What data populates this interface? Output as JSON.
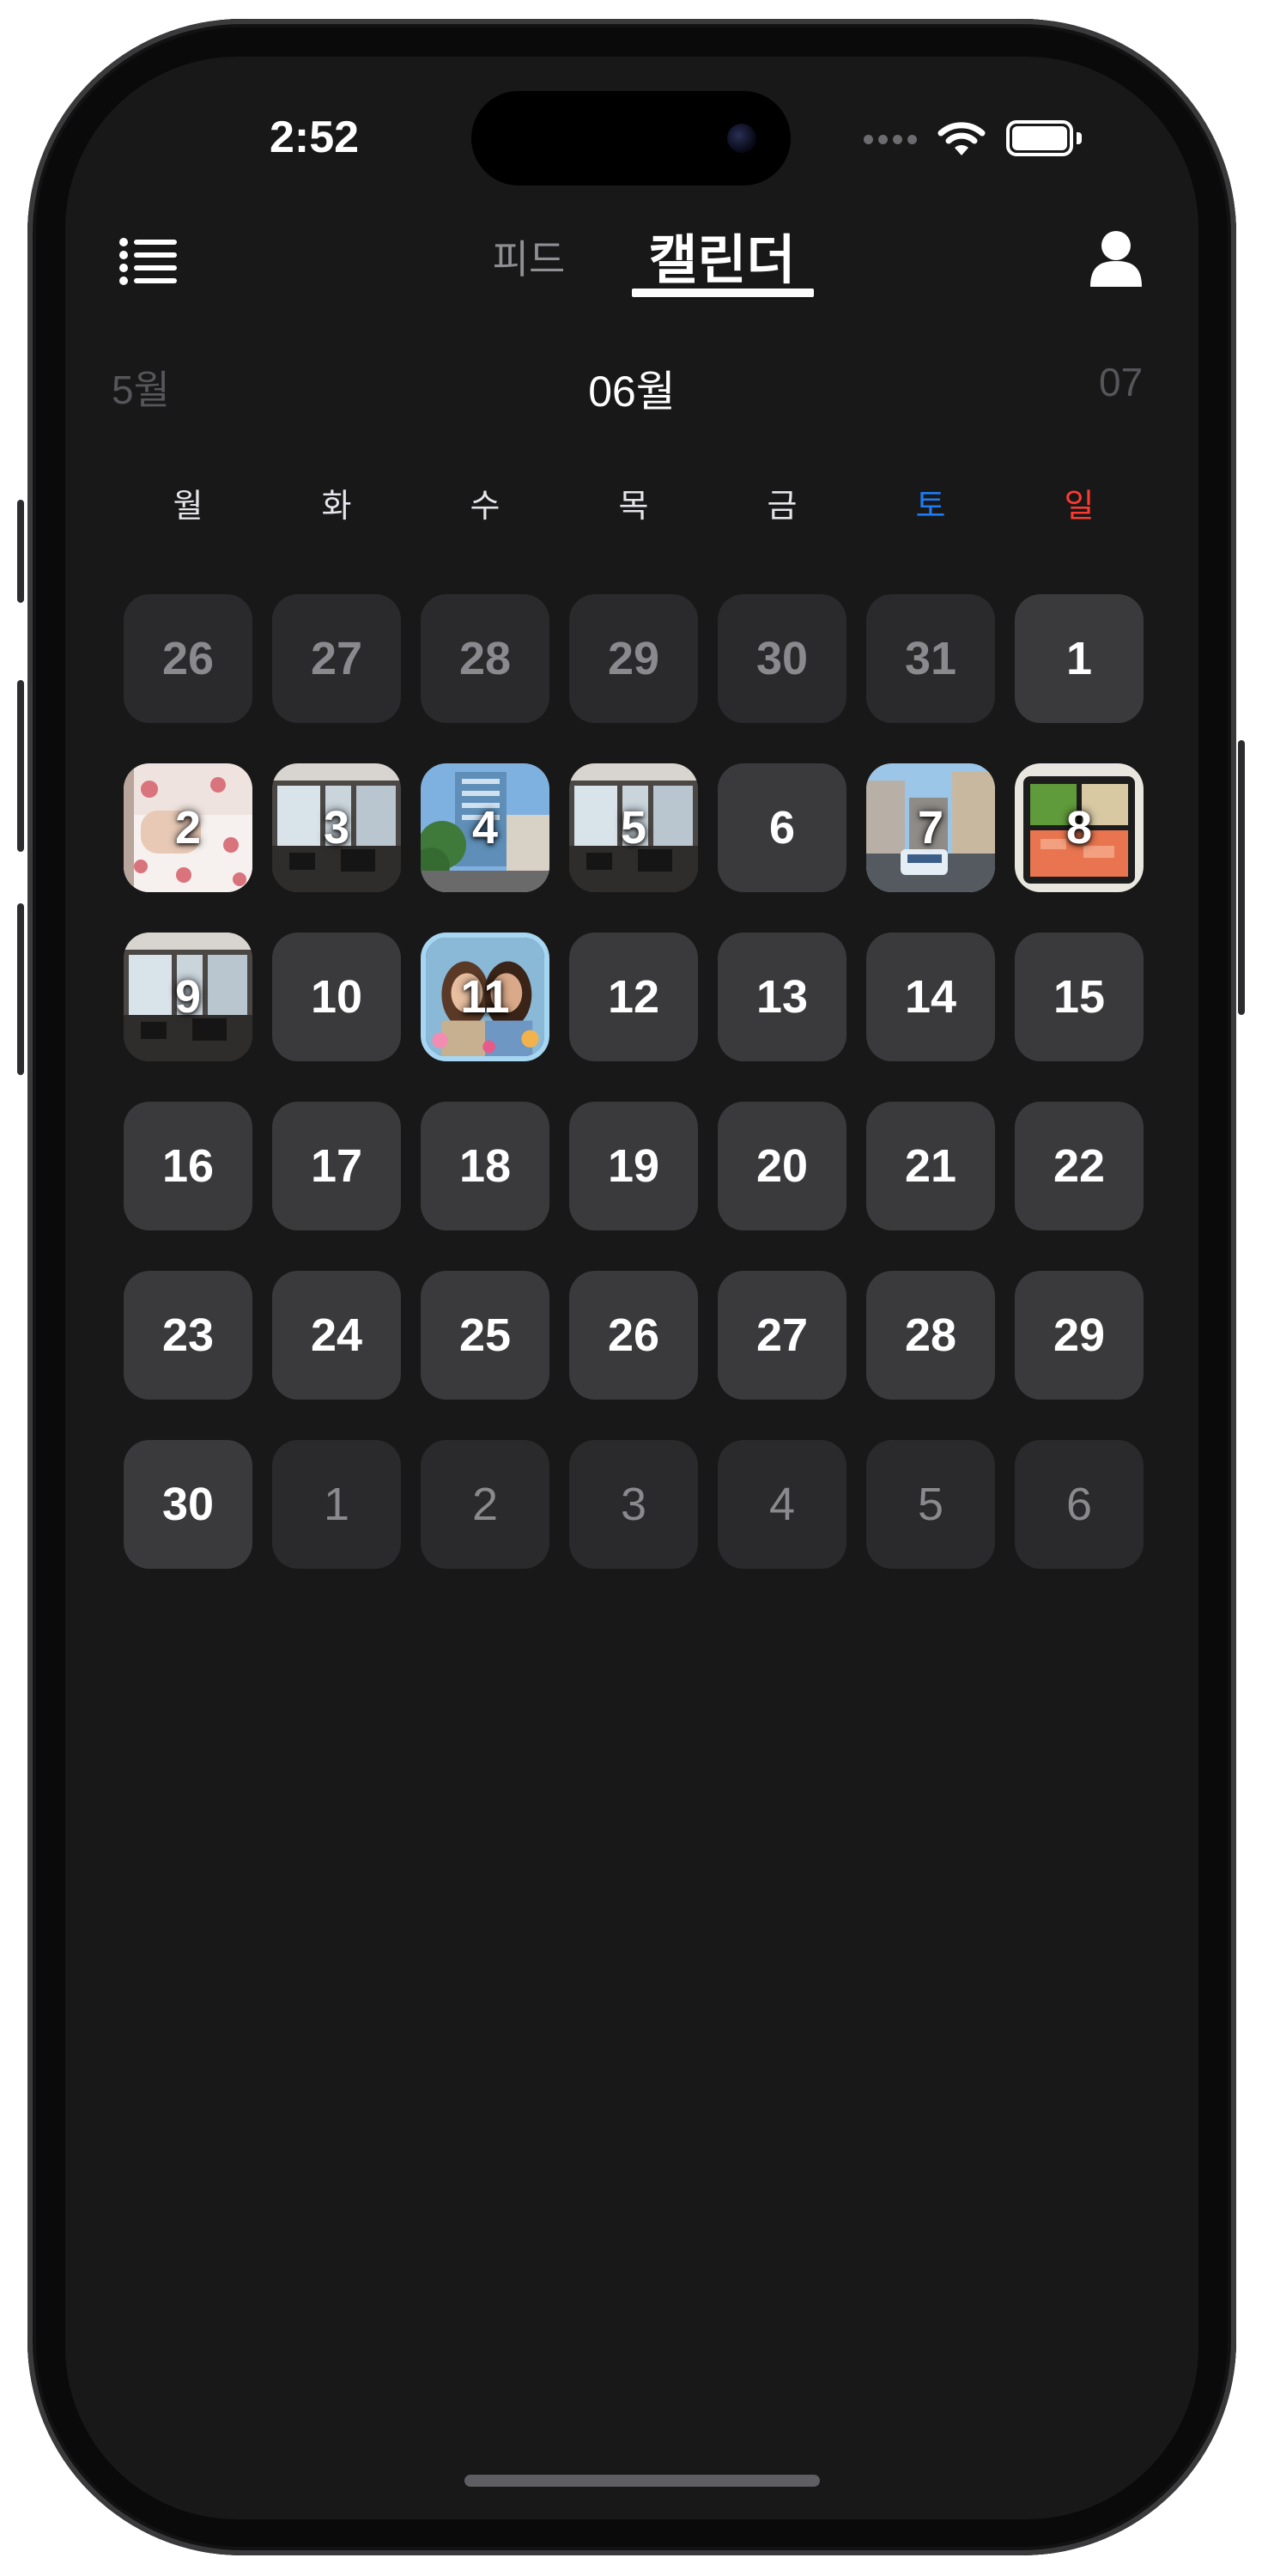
{
  "status_bar": {
    "time": "2:52"
  },
  "header": {
    "tabs": [
      {
        "label": "피드",
        "selected": false
      },
      {
        "label": "캘린더",
        "selected": true
      }
    ]
  },
  "month_nav": {
    "previous": "5월",
    "current": "06월",
    "next": "07"
  },
  "weekdays": [
    "월",
    "화",
    "수",
    "목",
    "금",
    "토",
    "일"
  ],
  "colors": {
    "background": "#181818",
    "saturday": "#1f7bf2",
    "sunday": "#ff3b30",
    "today_border": "#a7d6f2",
    "cell": "#3a3a3c",
    "cell_other_month": "#2a2a2c"
  },
  "calendar": {
    "weeks": [
      [
        {
          "day": "26",
          "month": "prev"
        },
        {
          "day": "27",
          "month": "prev"
        },
        {
          "day": "28",
          "month": "prev"
        },
        {
          "day": "29",
          "month": "prev"
        },
        {
          "day": "30",
          "month": "prev"
        },
        {
          "day": "31",
          "month": "prev"
        },
        {
          "day": "1",
          "month": "current"
        }
      ],
      [
        {
          "day": "2",
          "month": "current",
          "photo": "baby-bed-photo"
        },
        {
          "day": "3",
          "month": "current",
          "photo": "gym-room-photo"
        },
        {
          "day": "4",
          "month": "current",
          "photo": "building-street-photo"
        },
        {
          "day": "5",
          "month": "current",
          "photo": "gym-room-photo"
        },
        {
          "day": "6",
          "month": "current"
        },
        {
          "day": "7",
          "month": "current",
          "photo": "city-street-photo"
        },
        {
          "day": "8",
          "month": "current",
          "photo": "lunchbox-photo"
        }
      ],
      [
        {
          "day": "9",
          "month": "current",
          "photo": "gym-room-photo"
        },
        {
          "day": "10",
          "month": "current"
        },
        {
          "day": "11",
          "month": "current",
          "photo": "two-women-photo",
          "today": true
        },
        {
          "day": "12",
          "month": "current"
        },
        {
          "day": "13",
          "month": "current"
        },
        {
          "day": "14",
          "month": "current"
        },
        {
          "day": "15",
          "month": "current"
        }
      ],
      [
        {
          "day": "16",
          "month": "current"
        },
        {
          "day": "17",
          "month": "current"
        },
        {
          "day": "18",
          "month": "current"
        },
        {
          "day": "19",
          "month": "current"
        },
        {
          "day": "20",
          "month": "current"
        },
        {
          "day": "21",
          "month": "current"
        },
        {
          "day": "22",
          "month": "current"
        }
      ],
      [
        {
          "day": "23",
          "month": "current"
        },
        {
          "day": "24",
          "month": "current"
        },
        {
          "day": "25",
          "month": "current"
        },
        {
          "day": "26",
          "month": "current"
        },
        {
          "day": "27",
          "month": "current"
        },
        {
          "day": "28",
          "month": "current"
        },
        {
          "day": "29",
          "month": "current"
        }
      ],
      [
        {
          "day": "30",
          "month": "current"
        },
        {
          "day": "1",
          "month": "next"
        },
        {
          "day": "2",
          "month": "next"
        },
        {
          "day": "3",
          "month": "next"
        },
        {
          "day": "4",
          "month": "next"
        },
        {
          "day": "5",
          "month": "next"
        },
        {
          "day": "6",
          "month": "next"
        }
      ]
    ]
  }
}
